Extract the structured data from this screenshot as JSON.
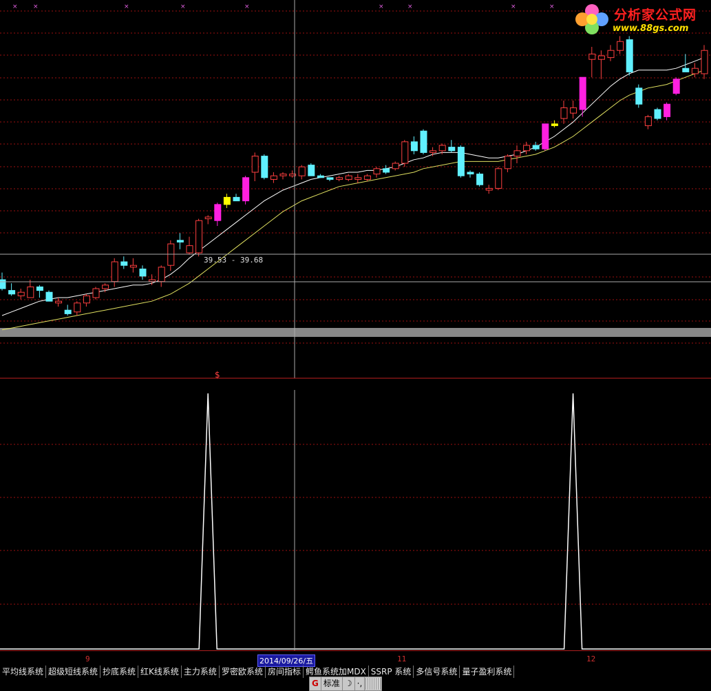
{
  "logo": {
    "title": "分析家公式网",
    "url": "www.88gs.com"
  },
  "crosshair": {
    "price_label": "39.53 - 39.68",
    "date_label": "2014/09/26/五"
  },
  "signal_marker": "$",
  "axis_ticks": [
    "9",
    "11",
    "12"
  ],
  "indicator_tabs": [
    "平均线系统",
    "超级短线系统",
    "抄底系统",
    "红K线系统",
    "主力系统",
    "罗密欧系统",
    "房间指标",
    "鳄鱼系统加MDX",
    "SSRP 系统",
    "多信号系统",
    "量子盈利系统"
  ],
  "toolbar": {
    "mode_label": "标准"
  },
  "colors": {
    "up": "#ff4040",
    "down": "#60f0ff",
    "signal": "#ff20e0",
    "alert": "#ffff00",
    "ma_short": "#ffffff",
    "ma_long": "#e0e060",
    "grid": "#a01010"
  },
  "chart_data": {
    "type": "candlestick",
    "candles": [
      {
        "o": 0.4,
        "h": 0.44,
        "l": 0.34,
        "c": 0.35,
        "k": "down"
      },
      {
        "o": 0.34,
        "h": 0.38,
        "l": 0.31,
        "c": 0.32,
        "k": "down"
      },
      {
        "o": 0.31,
        "h": 0.35,
        "l": 0.29,
        "c": 0.33,
        "k": "up"
      },
      {
        "o": 0.36,
        "h": 0.4,
        "l": 0.3,
        "c": 0.3,
        "k": "up"
      },
      {
        "o": 0.36,
        "h": 0.37,
        "l": 0.3,
        "c": 0.34,
        "k": "down"
      },
      {
        "o": 0.33,
        "h": 0.34,
        "l": 0.28,
        "c": 0.28,
        "k": "down"
      },
      {
        "o": 0.28,
        "h": 0.3,
        "l": 0.25,
        "c": 0.27,
        "k": "up"
      },
      {
        "o": 0.23,
        "h": 0.26,
        "l": 0.2,
        "c": 0.21,
        "k": "down"
      },
      {
        "o": 0.22,
        "h": 0.28,
        "l": 0.2,
        "c": 0.27,
        "k": "up"
      },
      {
        "o": 0.27,
        "h": 0.32,
        "l": 0.25,
        "c": 0.31,
        "k": "up"
      },
      {
        "o": 0.3,
        "h": 0.36,
        "l": 0.29,
        "c": 0.35,
        "k": "up"
      },
      {
        "o": 0.35,
        "h": 0.38,
        "l": 0.33,
        "c": 0.37,
        "k": "up"
      },
      {
        "o": 0.39,
        "h": 0.52,
        "l": 0.36,
        "c": 0.5,
        "k": "up"
      },
      {
        "o": 0.5,
        "h": 0.53,
        "l": 0.46,
        "c": 0.48,
        "k": "down"
      },
      {
        "o": 0.48,
        "h": 0.52,
        "l": 0.44,
        "c": 0.47,
        "k": "up"
      },
      {
        "o": 0.46,
        "h": 0.48,
        "l": 0.4,
        "c": 0.42,
        "k": "down"
      },
      {
        "o": 0.4,
        "h": 0.43,
        "l": 0.37,
        "c": 0.39,
        "k": "up"
      },
      {
        "o": 0.39,
        "h": 0.48,
        "l": 0.36,
        "c": 0.47,
        "k": "up"
      },
      {
        "o": 0.48,
        "h": 0.62,
        "l": 0.45,
        "c": 0.6,
        "k": "up"
      },
      {
        "o": 0.61,
        "h": 0.66,
        "l": 0.57,
        "c": 0.62,
        "k": "down"
      },
      {
        "o": 0.59,
        "h": 0.64,
        "l": 0.54,
        "c": 0.55,
        "k": "up"
      },
      {
        "o": 0.55,
        "h": 0.74,
        "l": 0.53,
        "c": 0.73,
        "k": "up"
      },
      {
        "o": 0.74,
        "h": 0.76,
        "l": 0.71,
        "c": 0.75,
        "k": "up"
      },
      {
        "o": 0.73,
        "h": 0.83,
        "l": 0.7,
        "c": 0.82,
        "k": "signal"
      },
      {
        "o": 0.82,
        "h": 0.88,
        "l": 0.8,
        "c": 0.86,
        "k": "alert"
      },
      {
        "o": 0.86,
        "h": 0.88,
        "l": 0.84,
        "c": 0.84,
        "k": "down"
      },
      {
        "o": 0.84,
        "h": 0.98,
        "l": 0.82,
        "c": 0.97,
        "k": "signal"
      },
      {
        "o": 1.0,
        "h": 1.11,
        "l": 0.95,
        "c": 1.09,
        "k": "up"
      },
      {
        "o": 1.09,
        "h": 1.1,
        "l": 0.96,
        "c": 0.97,
        "k": "down"
      },
      {
        "o": 0.96,
        "h": 1.0,
        "l": 0.94,
        "c": 0.98,
        "k": "up"
      },
      {
        "o": 0.98,
        "h": 1.0,
        "l": 0.96,
        "c": 0.99,
        "k": "up"
      },
      {
        "o": 0.99,
        "h": 1.01,
        "l": 0.97,
        "c": 0.98,
        "k": "up"
      },
      {
        "o": 0.98,
        "h": 1.04,
        "l": 0.96,
        "c": 1.03,
        "k": "up"
      },
      {
        "o": 1.04,
        "h": 1.05,
        "l": 0.98,
        "c": 0.98,
        "k": "down"
      },
      {
        "o": 0.98,
        "h": 0.99,
        "l": 0.97,
        "c": 0.97,
        "k": "down"
      },
      {
        "o": 0.97,
        "h": 0.97,
        "l": 0.95,
        "c": 0.96,
        "k": "down"
      },
      {
        "o": 0.96,
        "h": 0.98,
        "l": 0.95,
        "c": 0.97,
        "k": "up"
      },
      {
        "o": 0.96,
        "h": 0.99,
        "l": 0.95,
        "c": 0.98,
        "k": "up"
      },
      {
        "o": 0.97,
        "h": 0.99,
        "l": 0.94,
        "c": 0.96,
        "k": "up"
      },
      {
        "o": 0.96,
        "h": 0.99,
        "l": 0.95,
        "c": 0.98,
        "k": "up"
      },
      {
        "o": 0.99,
        "h": 1.03,
        "l": 0.97,
        "c": 1.02,
        "k": "up"
      },
      {
        "o": 1.02,
        "h": 1.04,
        "l": 0.99,
        "c": 1.0,
        "k": "down"
      },
      {
        "o": 1.02,
        "h": 1.06,
        "l": 1.01,
        "c": 1.05,
        "k": "up"
      },
      {
        "o": 1.05,
        "h": 1.18,
        "l": 1.03,
        "c": 1.17,
        "k": "up"
      },
      {
        "o": 1.17,
        "h": 1.2,
        "l": 1.1,
        "c": 1.12,
        "k": "down"
      },
      {
        "o": 1.11,
        "h": 1.24,
        "l": 1.1,
        "c": 1.23,
        "k": "down"
      },
      {
        "o": 1.12,
        "h": 1.14,
        "l": 1.09,
        "c": 1.11,
        "k": "up"
      },
      {
        "o": 1.12,
        "h": 1.16,
        "l": 1.1,
        "c": 1.15,
        "k": "up"
      },
      {
        "o": 1.14,
        "h": 1.18,
        "l": 1.11,
        "c": 1.12,
        "k": "down"
      },
      {
        "o": 1.14,
        "h": 1.15,
        "l": 0.97,
        "c": 0.98,
        "k": "down"
      },
      {
        "o": 0.99,
        "h": 1.01,
        "l": 0.97,
        "c": 1.0,
        "k": "down"
      },
      {
        "o": 0.99,
        "h": 1.0,
        "l": 0.92,
        "c": 0.93,
        "k": "down"
      },
      {
        "o": 0.9,
        "h": 0.93,
        "l": 0.88,
        "c": 0.91,
        "k": "up"
      },
      {
        "o": 0.91,
        "h": 1.03,
        "l": 0.9,
        "c": 1.02,
        "k": "up"
      },
      {
        "o": 1.02,
        "h": 1.1,
        "l": 1.0,
        "c": 1.09,
        "k": "up"
      },
      {
        "o": 1.09,
        "h": 1.15,
        "l": 1.05,
        "c": 1.12,
        "k": "up"
      },
      {
        "o": 1.12,
        "h": 1.17,
        "l": 1.1,
        "c": 1.15,
        "k": "up"
      },
      {
        "o": 1.15,
        "h": 1.17,
        "l": 1.12,
        "c": 1.13,
        "k": "down"
      },
      {
        "o": 1.13,
        "h": 1.27,
        "l": 1.12,
        "c": 1.27,
        "k": "signal"
      },
      {
        "o": 1.27,
        "h": 1.29,
        "l": 1.25,
        "c": 1.26,
        "k": "alert"
      },
      {
        "o": 1.3,
        "h": 1.4,
        "l": 1.27,
        "c": 1.36,
        "k": "up"
      },
      {
        "o": 1.33,
        "h": 1.4,
        "l": 1.3,
        "c": 1.36,
        "k": "up"
      },
      {
        "o": 1.35,
        "h": 1.53,
        "l": 1.31,
        "c": 1.53,
        "k": "signal"
      },
      {
        "o": 1.63,
        "h": 1.7,
        "l": 1.53,
        "c": 1.66,
        "k": "up"
      },
      {
        "o": 1.65,
        "h": 1.68,
        "l": 1.52,
        "c": 1.63,
        "k": "up"
      },
      {
        "o": 1.64,
        "h": 1.71,
        "l": 1.62,
        "c": 1.68,
        "k": "up"
      },
      {
        "o": 1.68,
        "h": 1.76,
        "l": 1.66,
        "c": 1.73,
        "k": "up"
      },
      {
        "o": 1.74,
        "h": 1.76,
        "l": 1.54,
        "c": 1.56,
        "k": "down"
      },
      {
        "o": 1.47,
        "h": 1.49,
        "l": 1.36,
        "c": 1.38,
        "k": "down"
      },
      {
        "o": 1.31,
        "h": 1.32,
        "l": 1.24,
        "c": 1.26,
        "k": "up"
      },
      {
        "o": 1.35,
        "h": 1.36,
        "l": 1.29,
        "c": 1.3,
        "k": "down"
      },
      {
        "o": 1.31,
        "h": 1.39,
        "l": 1.29,
        "c": 1.38,
        "k": "signal"
      },
      {
        "o": 1.44,
        "h": 1.53,
        "l": 1.43,
        "c": 1.52,
        "k": "signal"
      },
      {
        "o": 1.58,
        "h": 1.66,
        "l": 1.56,
        "c": 1.56,
        "k": "down"
      },
      {
        "o": 1.55,
        "h": 1.61,
        "l": 1.53,
        "c": 1.58,
        "k": "up"
      },
      {
        "o": 1.55,
        "h": 1.71,
        "l": 1.52,
        "c": 1.68,
        "k": "up"
      }
    ],
    "ma_short": [
      0.2,
      0.22,
      0.24,
      0.26,
      0.28,
      0.29,
      0.3,
      0.3,
      0.31,
      0.32,
      0.33,
      0.34,
      0.35,
      0.36,
      0.37,
      0.37,
      0.38,
      0.4,
      0.43,
      0.47,
      0.52,
      0.56,
      0.6,
      0.64,
      0.68,
      0.72,
      0.76,
      0.8,
      0.84,
      0.87,
      0.9,
      0.92,
      0.94,
      0.96,
      0.97,
      0.98,
      0.99,
      1.0,
      1.0,
      1.01,
      1.01,
      1.02,
      1.03,
      1.05,
      1.07,
      1.08,
      1.1,
      1.11,
      1.11,
      1.11,
      1.1,
      1.09,
      1.08,
      1.08,
      1.09,
      1.1,
      1.12,
      1.14,
      1.17,
      1.2,
      1.24,
      1.28,
      1.33,
      1.38,
      1.43,
      1.48,
      1.52,
      1.55,
      1.57,
      1.57,
      1.57,
      1.57,
      1.58,
      1.6,
      1.62,
      1.64
    ],
    "ma_long": [
      0.12,
      0.13,
      0.14,
      0.15,
      0.16,
      0.17,
      0.18,
      0.19,
      0.2,
      0.21,
      0.22,
      0.23,
      0.24,
      0.25,
      0.26,
      0.27,
      0.28,
      0.3,
      0.32,
      0.35,
      0.38,
      0.42,
      0.46,
      0.5,
      0.54,
      0.58,
      0.62,
      0.66,
      0.7,
      0.74,
      0.78,
      0.81,
      0.84,
      0.86,
      0.88,
      0.9,
      0.92,
      0.93,
      0.94,
      0.95,
      0.96,
      0.97,
      0.98,
      0.99,
      1.0,
      1.02,
      1.03,
      1.04,
      1.05,
      1.06,
      1.06,
      1.06,
      1.06,
      1.06,
      1.07,
      1.08,
      1.09,
      1.1,
      1.12,
      1.14,
      1.17,
      1.2,
      1.24,
      1.28,
      1.32,
      1.36,
      1.4,
      1.43,
      1.45,
      1.47,
      1.48,
      1.49,
      1.51,
      1.53,
      1.55,
      1.57
    ],
    "osc_spikes": [
      22,
      61
    ]
  }
}
